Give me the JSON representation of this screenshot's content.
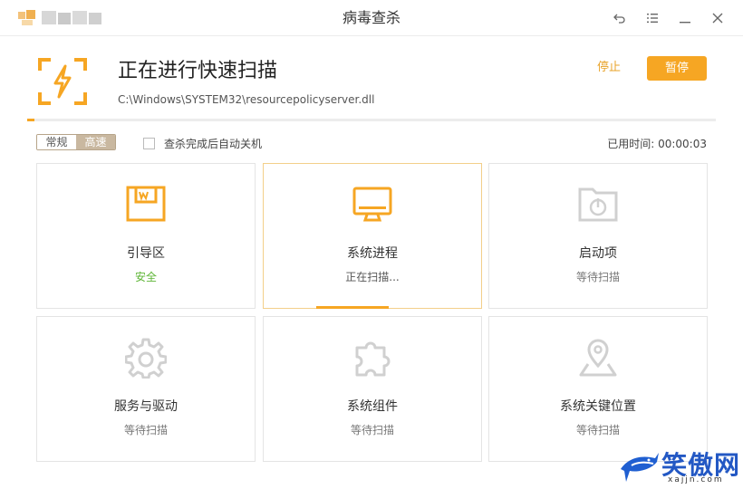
{
  "window": {
    "title": "病毒查杀",
    "controls": [
      "back-icon",
      "menu-icon",
      "minimize-icon",
      "close-icon"
    ]
  },
  "scan": {
    "title": "正在进行快速扫描",
    "current_file": "C:\\Windows\\SYSTEM32\\resourcepolicyserver.dll",
    "progress_fraction": 0.01,
    "stop_label": "停止",
    "pause_label": "暂停",
    "icon": "lightning-scan-icon"
  },
  "options": {
    "mode_normal": "常规",
    "mode_fast": "高速",
    "selected_mode": "高速",
    "auto_shutdown_label": "查杀完成后自动关机",
    "auto_shutdown_checked": false,
    "elapsed_label": "已用时间: 00:00:03"
  },
  "cards": [
    {
      "name": "引导区",
      "status": "安全",
      "icon": "bootsector-icon",
      "state": "safe"
    },
    {
      "name": "系统进程",
      "status": "正在扫描...",
      "icon": "monitor-icon",
      "state": "scanning"
    },
    {
      "name": "启动项",
      "status": "等待扫描",
      "icon": "power-folder-icon",
      "state": "waiting"
    },
    {
      "name": "服务与驱动",
      "status": "等待扫描",
      "icon": "gear-icon",
      "state": "waiting"
    },
    {
      "name": "系统组件",
      "status": "等待扫描",
      "icon": "puzzle-icon",
      "state": "waiting"
    },
    {
      "name": "系统关键位置",
      "status": "等待扫描",
      "icon": "location-pin-icon",
      "state": "waiting"
    }
  ],
  "watermark": {
    "text": "笑傲网",
    "sub": "xajjn.com"
  },
  "colors": {
    "accent": "#f6a623",
    "safe": "#5eb536",
    "watermark": "#2358c4"
  }
}
